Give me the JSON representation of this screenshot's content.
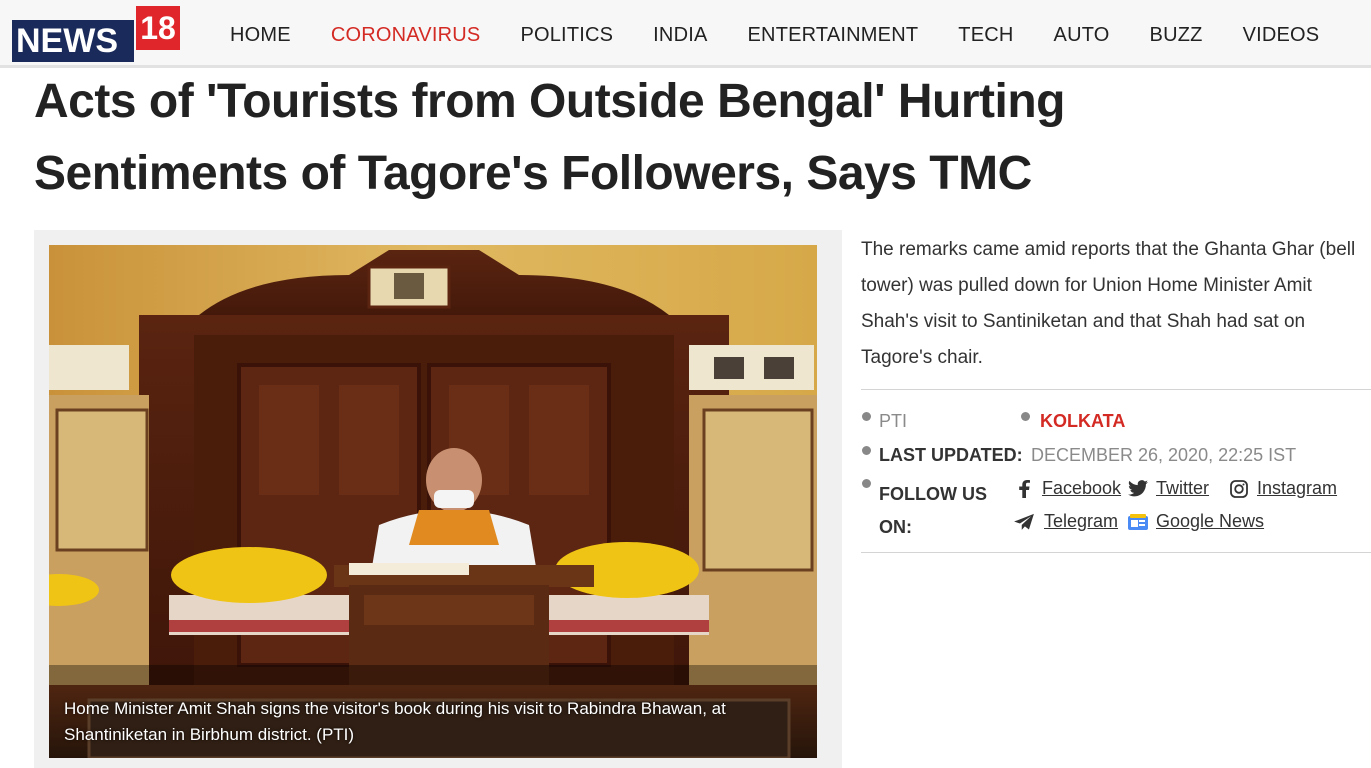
{
  "brand": {
    "logo_text": "NEWS",
    "logo_number": "18"
  },
  "nav": {
    "items": [
      {
        "label": "HOME"
      },
      {
        "label": "CORONAVIRUS",
        "active": true
      },
      {
        "label": "POLITICS"
      },
      {
        "label": "INDIA"
      },
      {
        "label": "ENTERTAINMENT"
      },
      {
        "label": "TECH"
      },
      {
        "label": "AUTO"
      },
      {
        "label": "BUZZ"
      },
      {
        "label": "VIDEOS"
      }
    ]
  },
  "article": {
    "headline_line1": "Acts of 'Tourists from Outside Bengal' Hurting",
    "headline_line2": "Sentiments of Tagore's Followers, Says TMC",
    "summary": "The remarks came amid reports that the Ghanta Ghar (bell tower) was pulled down for Union Home Minister Amit Shah's visit to Santiniketan and that Shah had sat on Tagore's chair.",
    "image_caption": "Home Minister Amit Shah signs the visitor's book during his visit to Rabindra Bhawan, at Shantiniketan in Birbhum district. (PTI)",
    "source": "PTI",
    "location": "KOLKATA",
    "last_updated_label": "LAST UPDATED:",
    "last_updated_value": "DECEMBER 26, 2020, 22:25 IST",
    "follow_label_line1": "FOLLOW US",
    "follow_label_line2": "ON:",
    "social": {
      "facebook": "Facebook",
      "twitter": "Twitter",
      "instagram": "Instagram",
      "telegram": "Telegram",
      "google_news": "Google News"
    }
  },
  "colors": {
    "accent": "#d42a24",
    "brand_navy": "#1a2a5a",
    "muted": "#8a8a8a"
  }
}
